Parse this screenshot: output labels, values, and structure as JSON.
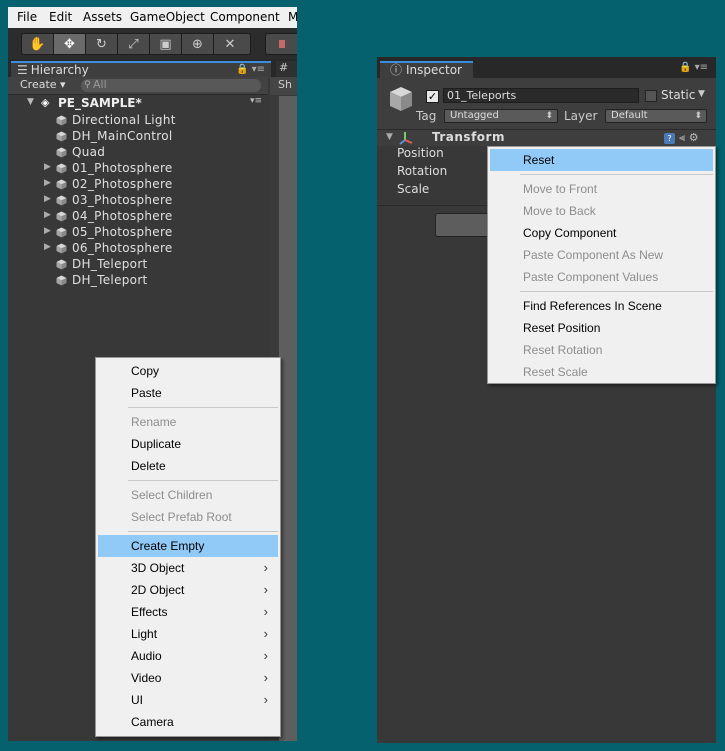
{
  "menubar": [
    "File",
    "Edit",
    "Assets",
    "GameObject",
    "Component",
    "M"
  ],
  "toolbar": {
    "tools": [
      "hand-tool-icon",
      "move-tool-icon",
      "rotate-tool-icon",
      "scale-tool-icon",
      "rect-tool-icon",
      "transform-tool-icon",
      "custom-tool-icon"
    ],
    "play_label": "P"
  },
  "hierarchy": {
    "tab_label": "Hierarchy",
    "create_label": "Create ▾",
    "search_placeholder": "All",
    "scene_name": "PE_SAMPLE*",
    "scene_tab_label": "Sh",
    "items": [
      {
        "label": "Directional Light",
        "expandable": false
      },
      {
        "label": "DH_MainControl",
        "expandable": false
      },
      {
        "label": "Quad",
        "expandable": false
      },
      {
        "label": "01_Photosphere",
        "expandable": true
      },
      {
        "label": "02_Photosphere",
        "expandable": true
      },
      {
        "label": "03_Photosphere",
        "expandable": true
      },
      {
        "label": "04_Photosphere",
        "expandable": true
      },
      {
        "label": "05_Photosphere",
        "expandable": true
      },
      {
        "label": "06_Photosphere",
        "expandable": true
      },
      {
        "label": "DH_Teleport",
        "expandable": false
      },
      {
        "label": "DH_Teleport",
        "expandable": false
      }
    ]
  },
  "hierarchy_menu": {
    "items": [
      {
        "label": "Copy",
        "disabled": false
      },
      {
        "label": "Paste",
        "disabled": false
      },
      {
        "sep": true
      },
      {
        "label": "Rename",
        "disabled": true
      },
      {
        "label": "Duplicate",
        "disabled": false
      },
      {
        "label": "Delete",
        "disabled": false
      },
      {
        "sep": true
      },
      {
        "label": "Select Children",
        "disabled": true
      },
      {
        "label": "Select Prefab Root",
        "disabled": true
      },
      {
        "sep": true
      },
      {
        "label": "Create Empty",
        "disabled": false,
        "highlight": true
      },
      {
        "label": "3D Object",
        "submenu": true
      },
      {
        "label": "2D Object",
        "submenu": true
      },
      {
        "label": "Effects",
        "submenu": true
      },
      {
        "label": "Light",
        "submenu": true
      },
      {
        "label": "Audio",
        "submenu": true
      },
      {
        "label": "Video",
        "submenu": true
      },
      {
        "label": "UI",
        "submenu": true
      },
      {
        "label": "Camera",
        "disabled": false
      }
    ]
  },
  "inspector": {
    "tab_label": "Inspector",
    "object_name": "01_Teleports",
    "active": true,
    "static_label": "Static",
    "tag_label": "Tag",
    "tag_value": "Untagged",
    "layer_label": "Layer",
    "layer_value": "Default",
    "component_title": "Transform",
    "properties": [
      "Position",
      "Rotation",
      "Scale"
    ]
  },
  "inspector_menu": {
    "items": [
      {
        "label": "Reset",
        "disabled": false,
        "highlight": true
      },
      {
        "sep": true
      },
      {
        "label": "Move to Front",
        "disabled": true
      },
      {
        "label": "Move to Back",
        "disabled": true
      },
      {
        "label": "Copy Component",
        "disabled": false
      },
      {
        "label": "Paste Component As New",
        "disabled": true
      },
      {
        "label": "Paste Component Values",
        "disabled": true
      },
      {
        "sep": true
      },
      {
        "label": "Find References In Scene",
        "disabled": false
      },
      {
        "label": "Reset Position",
        "disabled": false
      },
      {
        "label": "Reset Rotation",
        "disabled": true
      },
      {
        "label": "Reset Scale",
        "disabled": true
      }
    ]
  },
  "colors": {
    "background": "#04616d",
    "panel": "#383838",
    "menu_highlight": "#91c9f7",
    "tab_accent": "#3a8edb"
  }
}
